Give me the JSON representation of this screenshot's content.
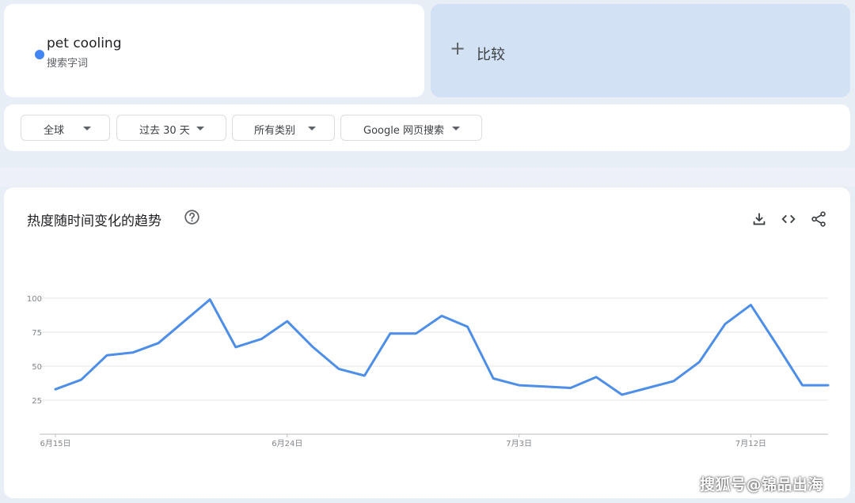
{
  "search_term": {
    "name": "pet cooling",
    "type": "搜索字词",
    "dot_color": "#4285f4"
  },
  "compare": {
    "icon": "plus-icon",
    "label": "比较"
  },
  "filters": [
    {
      "label": "全球"
    },
    {
      "label": "过去 30 天"
    },
    {
      "label": "所有类别"
    },
    {
      "label": "Google 网页搜索"
    }
  ],
  "chart_card": {
    "title": "热度随时间变化的趋势",
    "icons": [
      "help-icon",
      "download-icon",
      "embed-code-icon",
      "share-icon"
    ]
  },
  "chart_data": {
    "type": "line",
    "title": "",
    "xlabel": "",
    "ylabel": "",
    "ylim": [
      0,
      100
    ],
    "yticks": [
      25,
      50,
      75,
      100
    ],
    "grid": true,
    "x_tick_labels": [
      {
        "label": "6月15日",
        "day": "2023-06-15"
      },
      {
        "label": "6月24日",
        "day": "2023-06-24"
      },
      {
        "label": "7月3日",
        "day": "2023-07-03"
      },
      {
        "label": "7月12日",
        "day": "2023-07-12"
      }
    ],
    "x": [
      "2023-06-15",
      "2023-06-16",
      "2023-06-17",
      "2023-06-18",
      "2023-06-19",
      "2023-06-20",
      "2023-06-21",
      "2023-06-22",
      "2023-06-23",
      "2023-06-24",
      "2023-06-25",
      "2023-06-26",
      "2023-06-27",
      "2023-06-28",
      "2023-06-29",
      "2023-06-30",
      "2023-07-01",
      "2023-07-02",
      "2023-07-03",
      "2023-07-04",
      "2023-07-05",
      "2023-07-06",
      "2023-07-07",
      "2023-07-08",
      "2023-07-09",
      "2023-07-10",
      "2023-07-11",
      "2023-07-12",
      "2023-07-13",
      "2023-07-14",
      "2023-07-15"
    ],
    "series": [
      {
        "color": "#4d8ee8",
        "values": [
          33,
          40,
          58,
          60,
          67,
          83,
          99,
          64,
          70,
          83,
          64,
          48,
          43,
          74,
          74,
          87,
          79,
          41,
          36,
          35,
          34,
          42,
          29,
          34,
          39,
          53,
          81,
          95,
          66,
          36,
          36
        ]
      }
    ]
  },
  "watermark": "搜狐号@锦品出海"
}
